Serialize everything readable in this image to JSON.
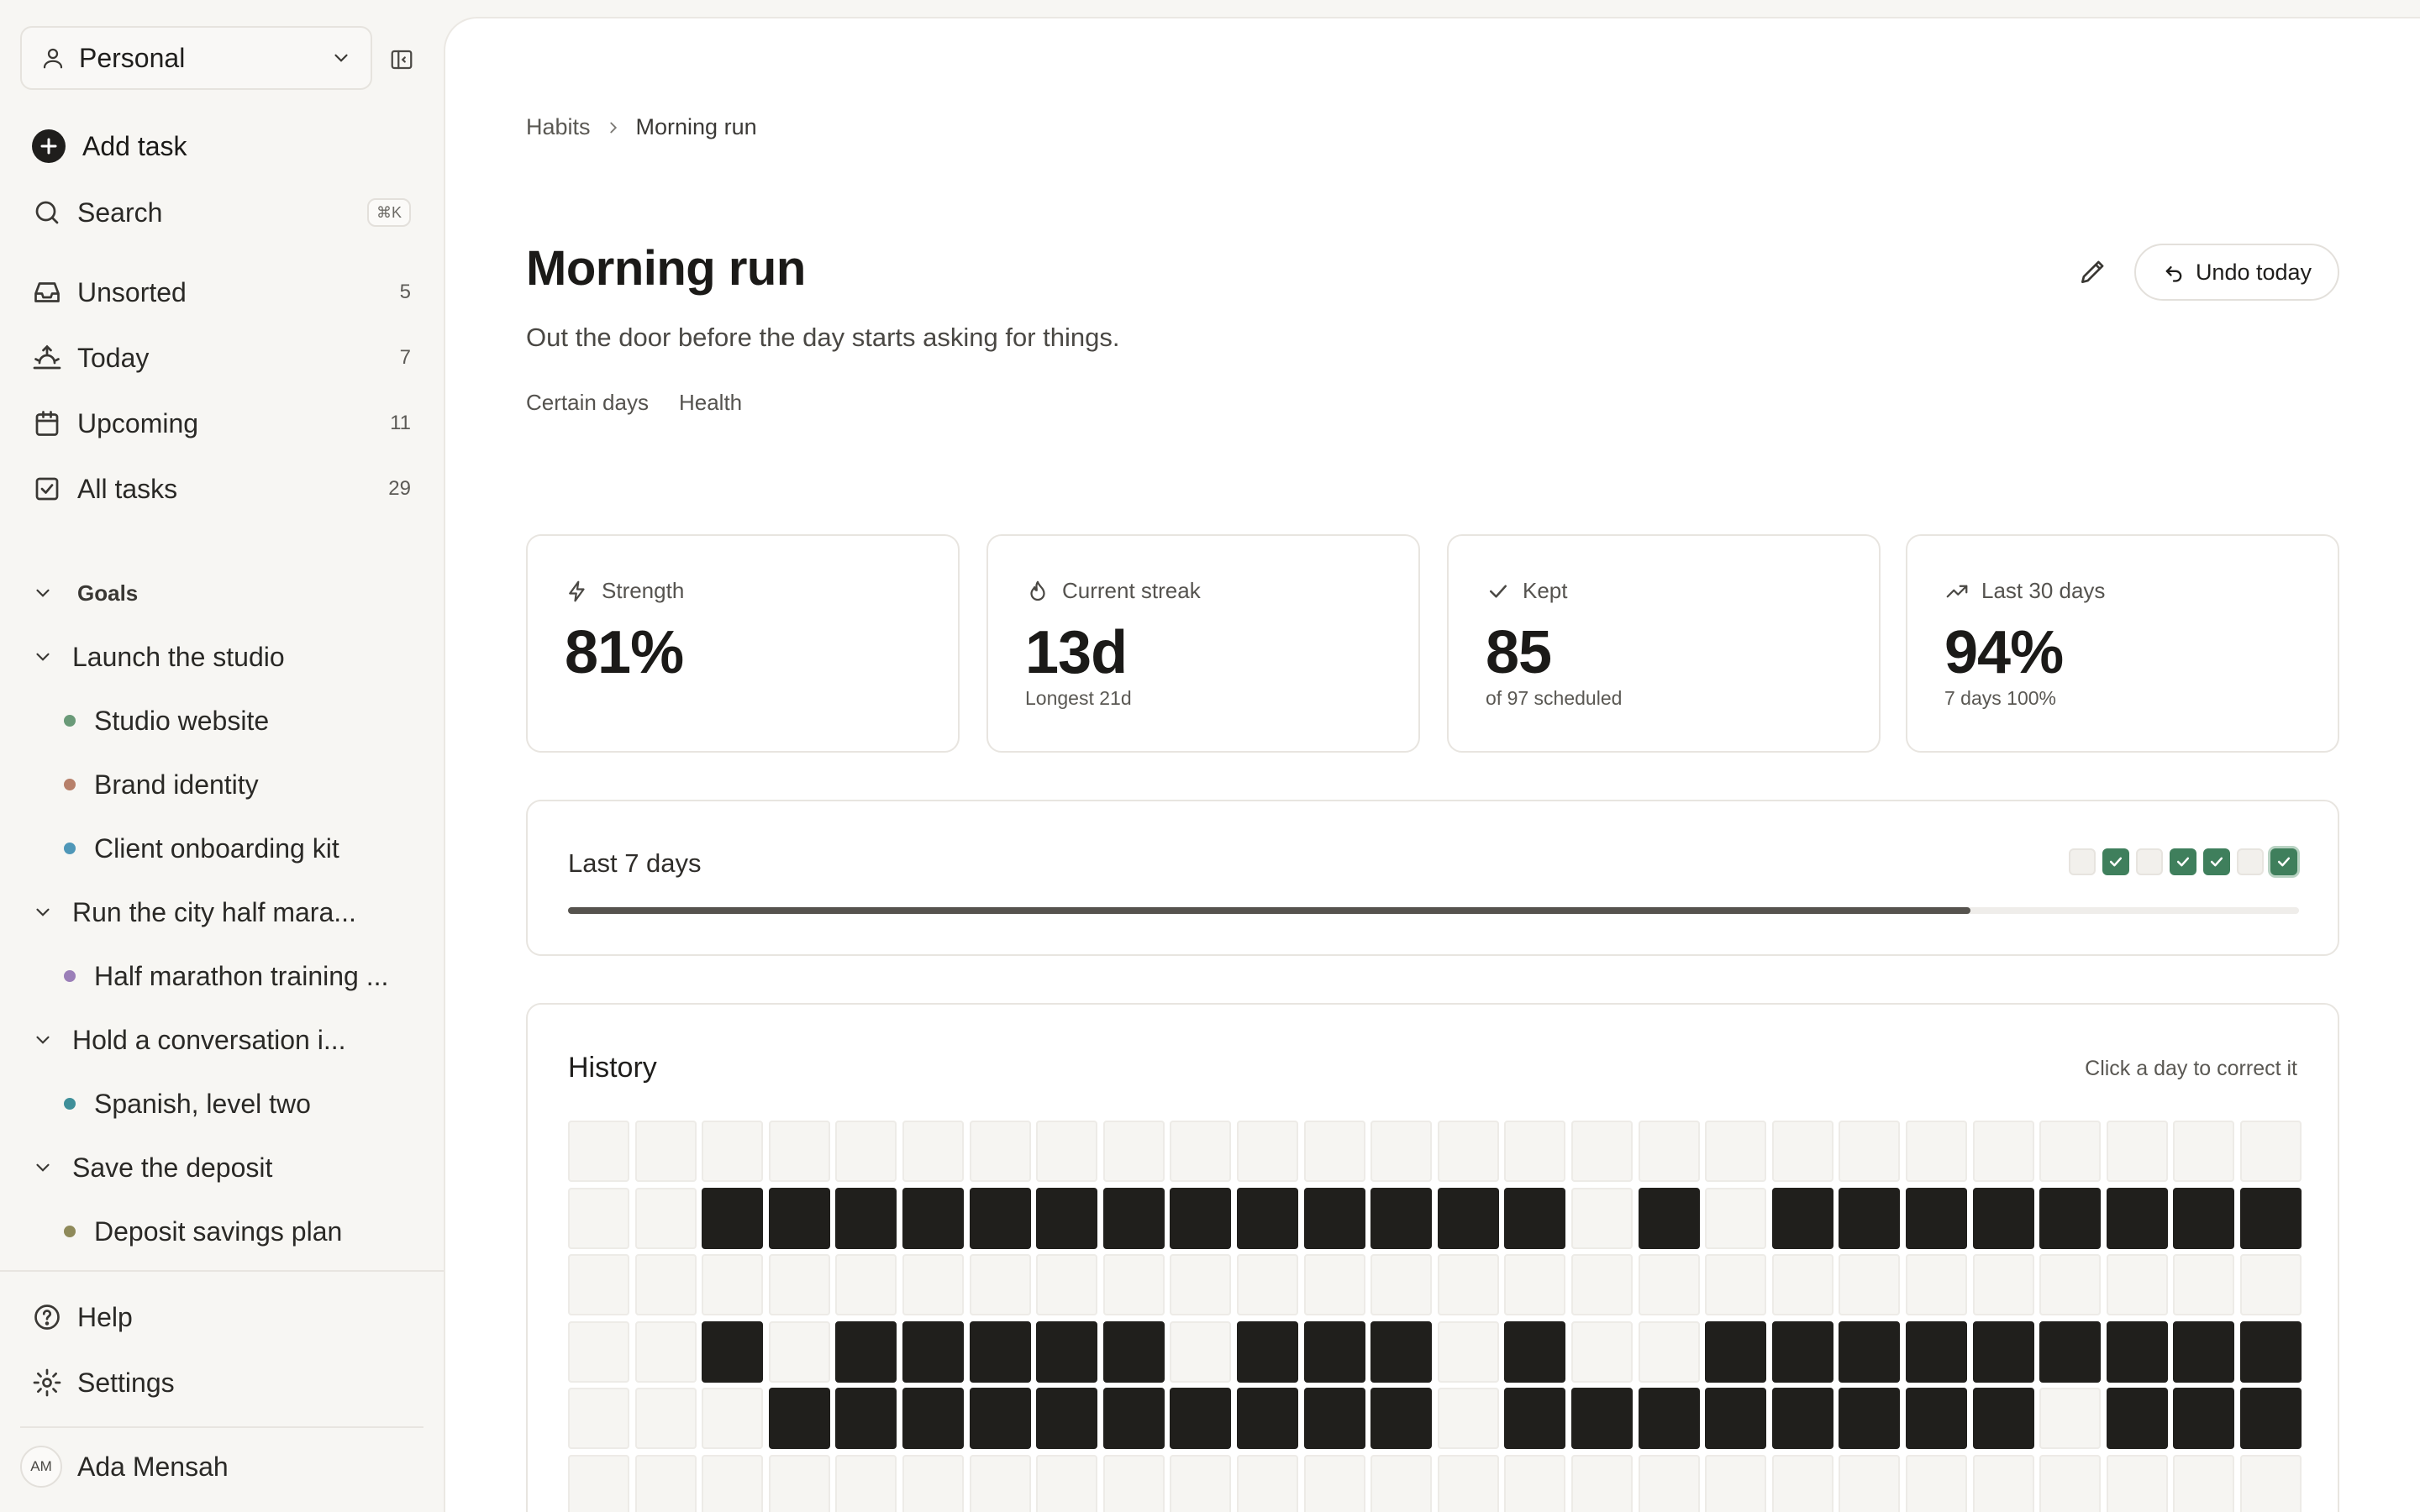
{
  "sidebar": {
    "workspace": "Personal",
    "add_task": "Add task",
    "search": {
      "label": "Search",
      "shortcut": "⌘K"
    },
    "nav": [
      {
        "label": "Unsorted",
        "count": "5",
        "icon": "inbox-icon"
      },
      {
        "label": "Today",
        "count": "7",
        "icon": "sunrise-icon"
      },
      {
        "label": "Upcoming",
        "count": "11",
        "icon": "calendar-icon"
      },
      {
        "label": "All tasks",
        "count": "29",
        "icon": "checkbox-icon"
      }
    ],
    "goals_label": "Goals",
    "goals": [
      {
        "label": "Launch the studio",
        "projects": [
          {
            "label": "Studio website",
            "color": "#6a9a78"
          },
          {
            "label": "Brand identity",
            "color": "#b7806a"
          },
          {
            "label": "Client onboarding kit",
            "color": "#4f97b8"
          }
        ]
      },
      {
        "label": "Run the city half mara...",
        "projects": [
          {
            "label": "Half marathon training ...",
            "color": "#9b7fb8"
          }
        ]
      },
      {
        "label": "Hold a conversation i...",
        "projects": [
          {
            "label": "Spanish, level two",
            "color": "#3f8f99"
          }
        ]
      },
      {
        "label": "Save the deposit",
        "projects": [
          {
            "label": "Deposit savings plan",
            "color": "#8f8a5a"
          }
        ]
      }
    ],
    "help": "Help",
    "settings": "Settings",
    "user": {
      "initials": "AM",
      "name": "Ada Mensah"
    }
  },
  "main": {
    "breadcrumb": [
      "Habits",
      "Morning run"
    ],
    "title": "Morning run",
    "description": "Out the door before the day starts asking for things.",
    "tags": [
      "Certain days",
      "Health"
    ],
    "undo_label": "Undo today",
    "stats": [
      {
        "label": "Strength",
        "value": "81%",
        "sub": "",
        "icon": "bolt-icon"
      },
      {
        "label": "Current streak",
        "value": "13d",
        "sub": "Longest 21d",
        "icon": "flame-icon"
      },
      {
        "label": "Kept",
        "value": "85",
        "sub": "of 97 scheduled",
        "icon": "check-icon"
      },
      {
        "label": "Last 30 days",
        "value": "94%",
        "sub": "7 days 100%",
        "icon": "trend-up-icon"
      }
    ],
    "last7": {
      "label": "Last 7 days",
      "days": [
        false,
        true,
        false,
        true,
        true,
        false,
        true
      ],
      "progress": 0.81
    },
    "history": {
      "title": "History",
      "hint": "Click a day to correct it",
      "rows": [
        "00000000000000000000000000",
        "00111111111111101011111111",
        "00000000000000000000000000",
        "00101111101110100111111111",
        "00011111111110111111110111",
        "00000000000000000000000000"
      ]
    }
  }
}
